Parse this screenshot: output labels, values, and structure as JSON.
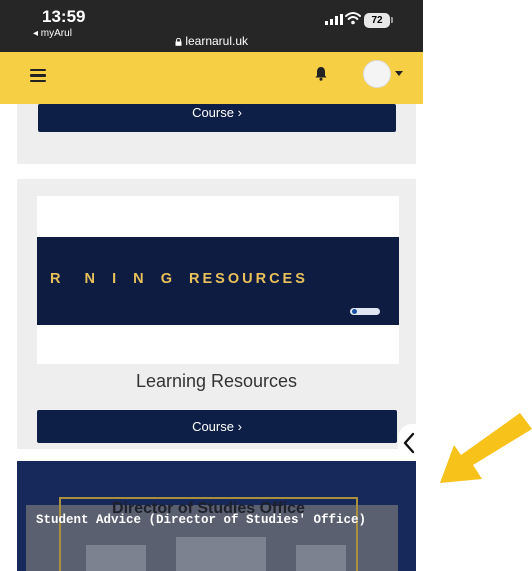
{
  "status_bar": {
    "time": "13:59",
    "back_app": "◂ myArul",
    "url": "learnarul.uk",
    "battery": "72"
  },
  "icons": {
    "menu": "hamburger-icon",
    "notifications": "bell-icon",
    "user": "avatar-icon",
    "user_menu": "caret-down-icon",
    "lock": "lock-icon",
    "drawer": "chevron-left-icon"
  },
  "cards": {
    "previous": {
      "button": "Course ›"
    },
    "learning_resources": {
      "banner_text": "R   N  I  N  G  RESOURCES",
      "title": "Learning Resources",
      "button": "Course ›"
    },
    "student_advice": {
      "caption": "Student Advice (Director of Studies' Office)",
      "image_text": "Director of Studies Office"
    }
  },
  "colors": {
    "status_bar": "#262626",
    "navbar": "#f7cf45",
    "button": "#0d1f47",
    "card": "#eeeeee",
    "annotation_arrow": "#f7c21a"
  }
}
